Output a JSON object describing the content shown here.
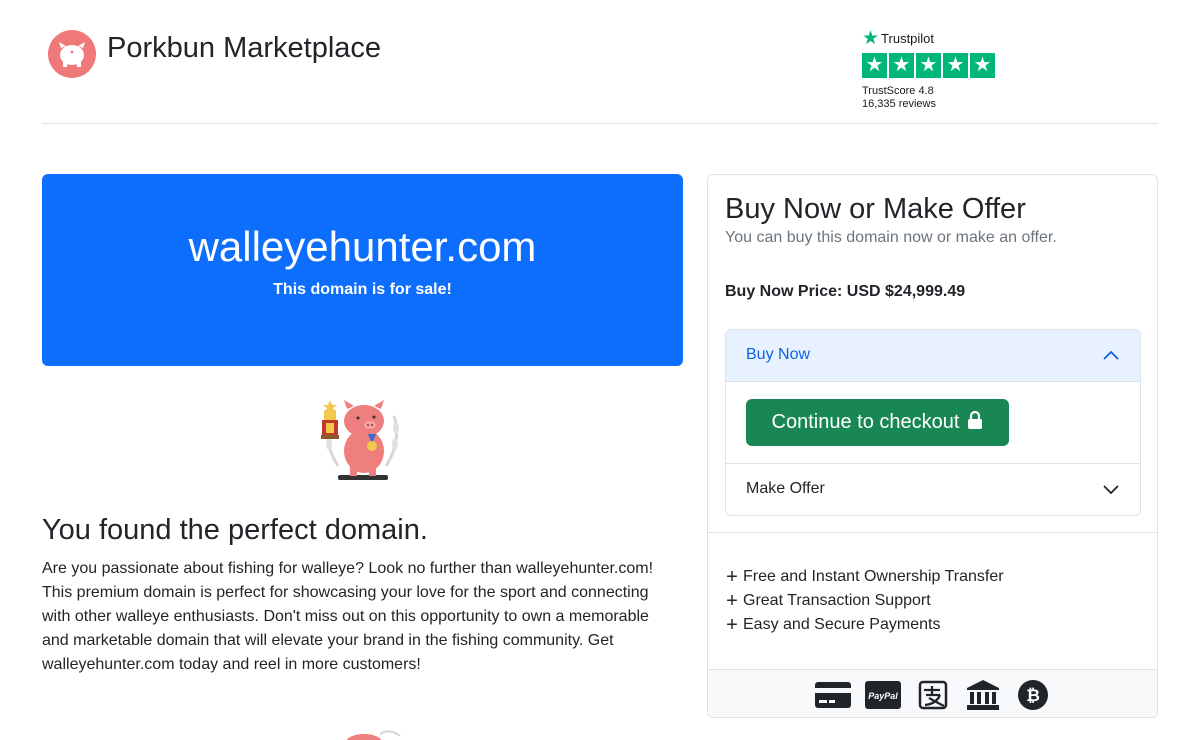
{
  "header": {
    "brand": "Porkbun Marketplace",
    "trustpilot": {
      "name": "Trustpilot",
      "score_label": "TrustScore 4.8",
      "reviews_label": "16,335 reviews"
    }
  },
  "hero": {
    "domain": "walleyehunter.com",
    "subtitle": "This domain is for sale!"
  },
  "perfect": {
    "title": "You found the perfect domain.",
    "body": "Are you passionate about fishing for walleye? Look no further than walleyehunter.com! This premium domain is perfect for showcasing your love for the sport and connecting with other walleye enthusiasts. Don't miss out on this opportunity to own a memorable and marketable domain that will elevate your brand in the fishing community. Get walleyehunter.com today and reel in more customers!"
  },
  "card": {
    "title": "Buy Now or Make Offer",
    "subtitle": "You can buy this domain now or make an offer.",
    "price": "Buy Now Price: USD $24,999.49",
    "accordion": {
      "buy_now_label": "Buy Now",
      "checkout_label": "Continue to checkout",
      "make_offer_label": "Make Offer"
    },
    "features": [
      "Free and Instant Ownership Transfer",
      "Great Transaction Support",
      "Easy and Secure Payments"
    ],
    "payment_icons": [
      "credit-card-icon",
      "paypal-icon",
      "alipay-icon",
      "bank-icon",
      "bitcoin-icon"
    ],
    "paypal_text": "PayPal"
  },
  "colors": {
    "primary": "#0d6efd",
    "success": "#198754",
    "trustpilot": "#00b67a",
    "logo": "#ef7878"
  }
}
